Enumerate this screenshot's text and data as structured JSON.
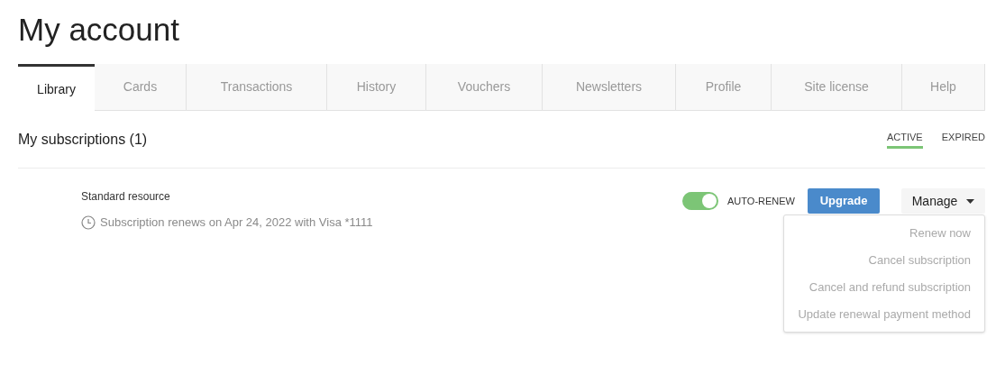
{
  "title": "My account",
  "tabs": [
    {
      "label": "Library",
      "selected": true
    },
    {
      "label": "Cards",
      "selected": false
    },
    {
      "label": "Transactions",
      "selected": false
    },
    {
      "label": "History",
      "selected": false
    },
    {
      "label": "Vouchers",
      "selected": false
    },
    {
      "label": "Newsletters",
      "selected": false
    },
    {
      "label": "Profile",
      "selected": false
    },
    {
      "label": "Site license",
      "selected": false
    },
    {
      "label": "Help",
      "selected": false
    }
  ],
  "section": {
    "heading": "My subscriptions (1)",
    "filters": [
      {
        "label": "ACTIVE",
        "selected": true
      },
      {
        "label": "EXPIRED",
        "selected": false
      }
    ]
  },
  "subscription": {
    "name": "Standard resource",
    "renewal": "Subscription renews on Apr 24, 2022 with Visa *1111",
    "auto_renew": {
      "label": "AUTO-RENEW",
      "on": true
    },
    "upgrade_button": "Upgrade",
    "manage_button": "Manage",
    "manage_menu": [
      "Renew now",
      "Cancel subscription",
      "Cancel and refund subscription",
      "Update renewal payment method"
    ]
  }
}
